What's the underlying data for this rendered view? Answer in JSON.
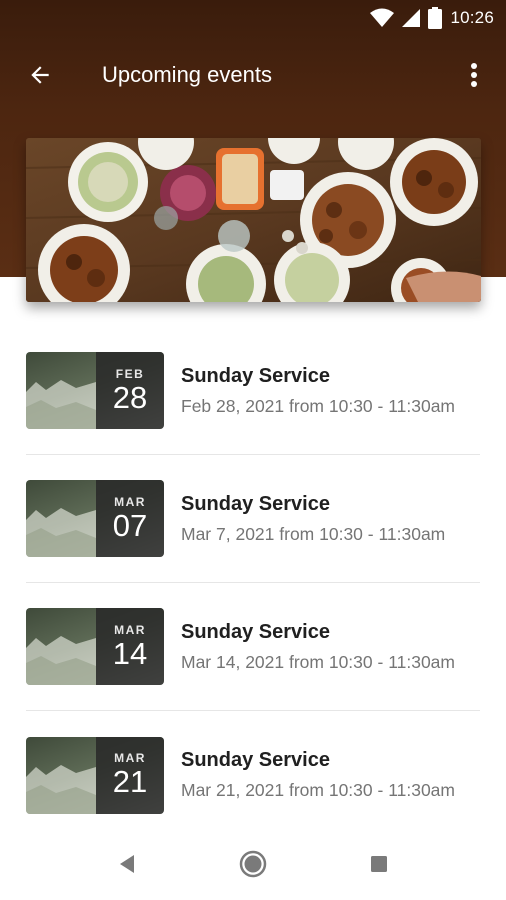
{
  "status_bar": {
    "time": "10:26",
    "icons": [
      "wifi-icon",
      "signal-icon",
      "battery-icon"
    ]
  },
  "app_bar": {
    "title": "Upcoming events",
    "back_icon": "arrow-back-icon",
    "menu_icon": "more-vert-icon"
  },
  "banner": {
    "image": "table-of-food-photo"
  },
  "events": [
    {
      "month": "FEB",
      "day": "28",
      "title": "Sunday Service",
      "subtitle": "Feb 28, 2021 from 10:30 - 11:30am"
    },
    {
      "month": "MAR",
      "day": "07",
      "title": "Sunday Service",
      "subtitle": "Mar 7, 2021 from 10:30 - 11:30am"
    },
    {
      "month": "MAR",
      "day": "14",
      "title": "Sunday Service",
      "subtitle": "Mar 14, 2021 from 10:30 - 11:30am"
    },
    {
      "month": "MAR",
      "day": "21",
      "title": "Sunday Service",
      "subtitle": "Mar 21, 2021 from 10:30 - 11:30am"
    }
  ],
  "nav_bar": {
    "icons": [
      "back-triangle-icon",
      "home-circle-icon",
      "recents-square-icon"
    ]
  },
  "colors": {
    "header": "#4d2610",
    "title_text": "#202020",
    "subtitle_text": "#757575",
    "badge": "#282828"
  }
}
